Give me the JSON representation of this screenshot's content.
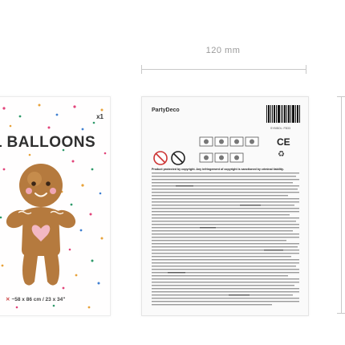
{
  "dimension_width_label": "120 mm",
  "front": {
    "count_label": "x1",
    "title_visible": "L BALLOONS",
    "size_label": "~58 x 86 cm / 23 x 34\"",
    "colors": {
      "balloon": "#b57a3e",
      "balloon_light": "#d49a58",
      "heart": "#f3b8c3",
      "cheek": "#f0a6b4"
    }
  },
  "back": {
    "brand": "PartyDeco",
    "symbol_code": "SYMBOL: FB33",
    "copyright": "Product protected by copyright. Any infringement of copyright is sanctioned by criminal liability.",
    "ce": "CE"
  }
}
